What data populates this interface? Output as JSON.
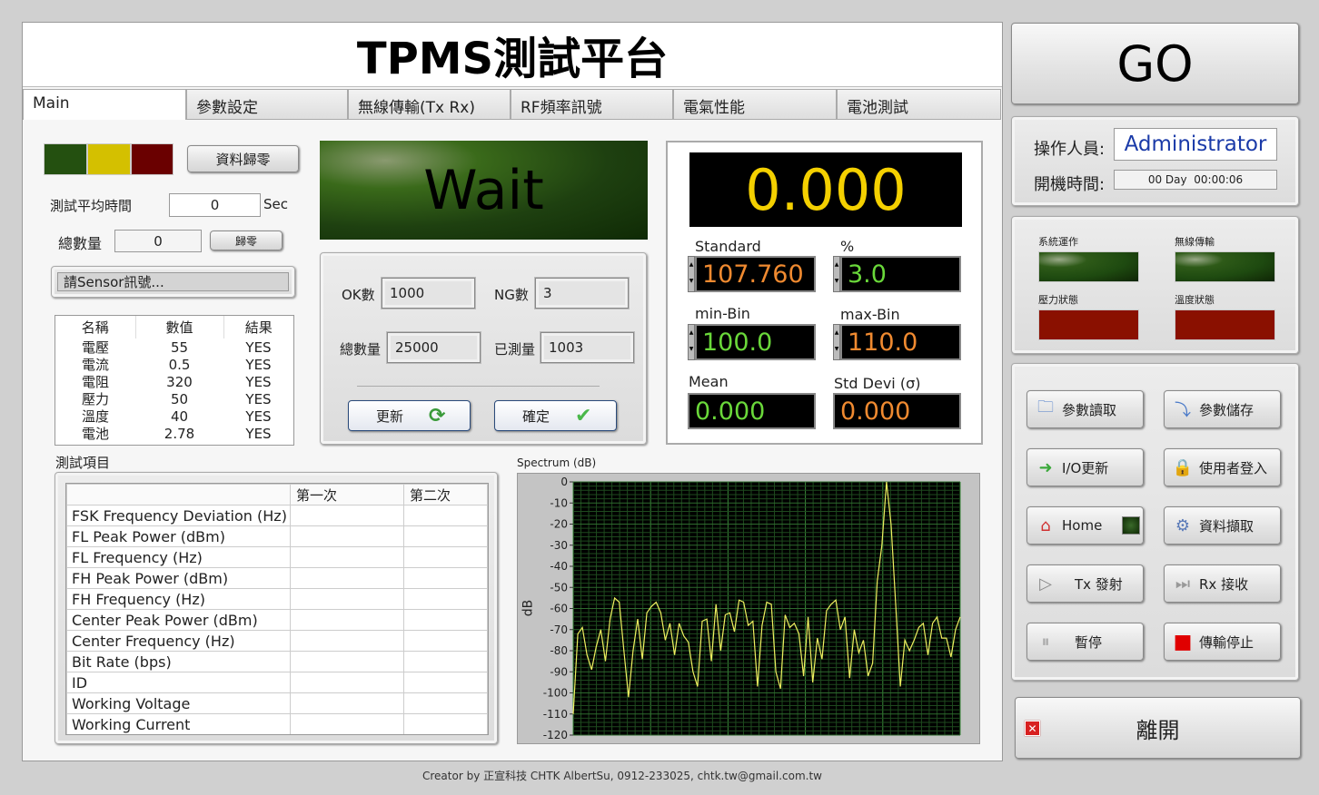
{
  "title": "TPMS測試平台",
  "tabs": [
    {
      "label": "Main"
    },
    {
      "label": "參數設定"
    },
    {
      "label": "無線傳輸(Tx Rx)"
    },
    {
      "label": "RF頻率訊號"
    },
    {
      "label": "電氣性能"
    },
    {
      "label": "電池測試"
    }
  ],
  "left": {
    "reset_data_label": "資料歸零",
    "avg_time_label": "測試平均時間",
    "avg_time_value": "0",
    "avg_time_unit": "Sec",
    "total_label": "總數量",
    "total_value": "0",
    "zero_label": "歸零",
    "sensor_prompt": "請Sensor訊號...",
    "result_table": {
      "headers": [
        "名稱",
        "數值",
        "結果"
      ],
      "rows": [
        [
          "電壓",
          "55",
          "YES"
        ],
        [
          "電流",
          "0.5",
          "YES"
        ],
        [
          "電阻",
          "320",
          "YES"
        ],
        [
          "壓力",
          "50",
          "YES"
        ],
        [
          "溫度",
          "40",
          "YES"
        ],
        [
          "電池",
          "2.78",
          "YES"
        ]
      ]
    },
    "led_colors": [
      "#245010",
      "#d4c000",
      "#6a0000"
    ]
  },
  "status": {
    "text": "Wait"
  },
  "counter": {
    "ok_label": "OK數",
    "ok_value": "1000",
    "ng_label": "NG數",
    "ng_value": "3",
    "total_label": "總數量",
    "total_value": "25000",
    "measured_label": "已測量",
    "measured_value": "1003",
    "refresh_label": "更新",
    "confirm_label": "確定"
  },
  "stats": {
    "main_value": "0.000",
    "standard_label": "Standard",
    "standard_value": "107.760",
    "percent_label": "%",
    "percent_value": "3.0",
    "min_bin_label": "min-Bin",
    "min_bin_value": "100.0",
    "max_bin_label": "max-Bin",
    "max_bin_value": "110.0",
    "mean_label": "Mean",
    "mean_value": "0.000",
    "std_label": "Std Devi (σ)",
    "std_value": "0.000"
  },
  "test_items": {
    "label": "測試項目",
    "headers": [
      "",
      "第一次",
      "第二次"
    ],
    "rows": [
      "FSK Frequency Deviation (Hz)",
      "FL Peak Power (dBm)",
      "FL Frequency (Hz)",
      "FH Peak Power (dBm)",
      "FH Frequency (Hz)",
      "Center Peak Power (dBm)",
      "Center Frequency (Hz)",
      "Bit Rate (bps)",
      "ID",
      "Working Voltage",
      "Working Current"
    ]
  },
  "chart_data": {
    "type": "line",
    "title": "Spectrum (dB)",
    "xlabel": "",
    "ylabel": "dB",
    "ylim": [
      -120,
      0
    ],
    "grid": true,
    "yticks": [
      "0",
      "-10",
      "-20",
      "-30",
      "-40",
      "-50",
      "-60",
      "-70",
      "-80",
      "-90",
      "-100",
      "-110",
      "-120"
    ],
    "line_color": "#f0f060",
    "plot_bg": "#000000",
    "values": [
      -110,
      -72,
      -69,
      -82,
      -89,
      -78,
      -70,
      -85,
      -65,
      -55,
      -57,
      -80,
      -102,
      -80,
      -65,
      -84,
      -62,
      -59,
      -57,
      -62,
      -75,
      -67,
      -82,
      -67,
      -73,
      -76,
      -90,
      -97,
      -66,
      -65,
      -85,
      -58,
      -80,
      -63,
      -62,
      -71,
      -56,
      -57,
      -68,
      -66,
      -97,
      -68,
      -57,
      -58,
      -90,
      -98,
      -63,
      -69,
      -67,
      -72,
      -92,
      -64,
      -95,
      -74,
      -84,
      -61,
      -58,
      -56,
      -70,
      -64,
      -93,
      -70,
      -81,
      -75,
      -92,
      -86,
      -47,
      -30,
      0,
      -20,
      -58,
      -97,
      -75,
      -80,
      -75,
      -69,
      -67,
      -82,
      -67,
      -64,
      -74,
      -74,
      -83,
      -70,
      -64
    ]
  },
  "go_label": "GO",
  "operator": {
    "label": "操作人員:",
    "value": "Administrator",
    "uptime_label": "開機時間:",
    "uptime_value": "00 Day  00:00:06"
  },
  "indicators": [
    {
      "label": "系統運作",
      "color": "#1e4a10"
    },
    {
      "label": "無線傳輸",
      "color": "#1e4a10"
    },
    {
      "label": "壓力狀態",
      "color": "#8a1000"
    },
    {
      "label": "溫度狀態",
      "color": "#8a1000"
    }
  ],
  "actions": [
    {
      "label": "參數讀取",
      "icon": "folder-icon"
    },
    {
      "label": "參數儲存",
      "icon": "save-drive-icon"
    },
    {
      "label": "I/O更新",
      "icon": "refresh-arrow-icon"
    },
    {
      "label": "使用者登入",
      "icon": "lock-icon"
    },
    {
      "label": "Home",
      "icon": "home-icon"
    },
    {
      "label": "資料擷取",
      "icon": "gear-icon"
    },
    {
      "label": "Tx 發射",
      "icon": "play-icon"
    },
    {
      "label": "Rx 接收",
      "icon": "skip-icon"
    },
    {
      "label": "暫停",
      "icon": "pause-icon"
    },
    {
      "label": "傳輸停止",
      "icon": "stop-icon"
    }
  ],
  "exit_label": "離開",
  "footer": "Creator by 正宣科技 CHTK AlbertSu, 0912-233025, chtk.tw@gmail.com.tw"
}
